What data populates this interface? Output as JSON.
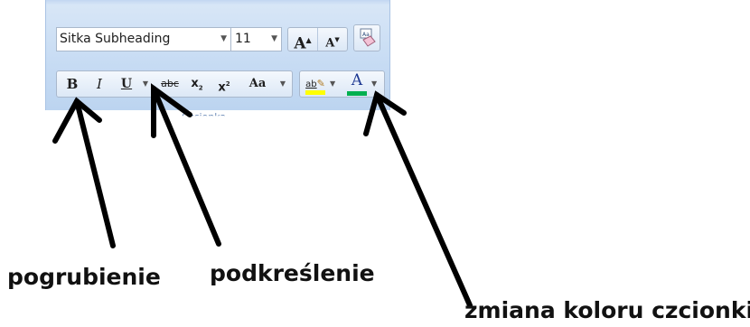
{
  "ribbon": {
    "font_name": "Sitka Subheading",
    "font_size": "11",
    "grow_font_glyph": "A",
    "shrink_font_glyph": "A",
    "clear_format_icon": "eraser-icon",
    "bold_glyph": "B",
    "italic_glyph": "I",
    "underline_glyph": "U",
    "strike_glyph": "abc",
    "subscript_glyph": "x",
    "subscript_mark": "2",
    "superscript_glyph": "x",
    "superscript_mark": "2",
    "case_glyph": "Aa",
    "highlight_glyph": "ab",
    "font_color_glyph": "A",
    "highlight_color": "#ffff00",
    "font_color": "#00b050",
    "group_label": "Czcionka"
  },
  "captions": {
    "bold": "pogrubienie",
    "underline": "podkreślenie",
    "font_color": "zmiana koloru czcionki"
  }
}
